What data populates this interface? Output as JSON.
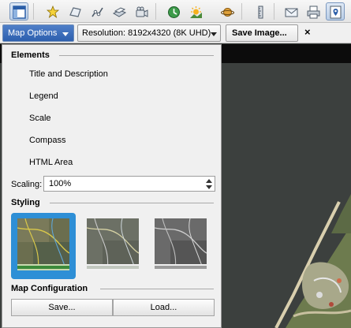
{
  "toolbar": {
    "buttons": [
      {
        "icon": "layout-icon",
        "active": true
      },
      {
        "icon": "add-placemark-icon"
      },
      {
        "icon": "add-polygon-icon"
      },
      {
        "icon": "add-path-icon"
      },
      {
        "icon": "add-overlay-icon"
      },
      {
        "icon": "record-tour-icon"
      },
      {
        "icon": "historical-imagery-icon"
      },
      {
        "icon": "sunlight-icon"
      },
      {
        "icon": "planets-icon"
      },
      {
        "icon": "ruler-icon"
      },
      {
        "icon": "email-icon"
      },
      {
        "icon": "print-icon"
      },
      {
        "icon": "save-image-icon",
        "active": true
      }
    ]
  },
  "options_bar": {
    "map_options": "Map Options",
    "resolution": "Resolution: 8192x4320 (8K UHD)",
    "save_image": "Save Image...",
    "close": "×"
  },
  "panel": {
    "elements_title": "Elements",
    "elements": [
      "Title and Description",
      "Legend",
      "Scale",
      "Compass",
      "HTML Area"
    ],
    "scaling_label": "Scaling:",
    "scaling_value": "100%",
    "styling_title": "Styling",
    "styles": [
      {
        "name": "style-color",
        "selected": true
      },
      {
        "name": "style-muted",
        "selected": false
      },
      {
        "name": "style-grayscale",
        "selected": false
      }
    ],
    "map_config_title": "Map Configuration",
    "save_button": "Save...",
    "load_button": "Load..."
  },
  "colors": {
    "accent": "#2e8fd6",
    "map_options_bg": "#3a6cbf",
    "water": "#3b3f3d",
    "land": "#6f7a4f"
  }
}
